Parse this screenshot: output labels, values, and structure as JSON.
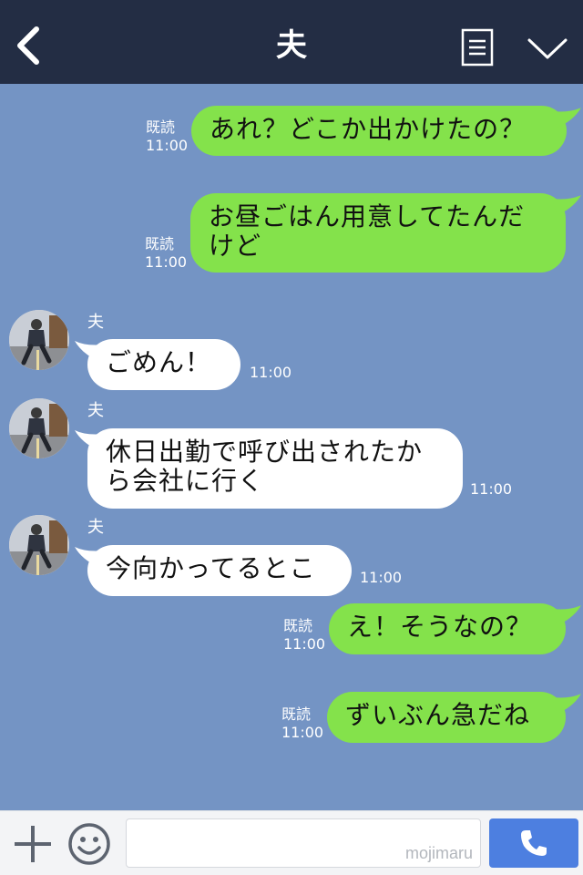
{
  "header": {
    "title": "夫"
  },
  "messages": [
    {
      "side": "right",
      "text": "あれ？どこか出かけたの？",
      "read": "既読",
      "time": "11:00"
    },
    {
      "side": "right",
      "text": "お昼ごはん用意してたんだけど",
      "read": "既読",
      "time": "11:00"
    },
    {
      "side": "left",
      "sender": "夫",
      "text": "ごめん！",
      "time": "11:00"
    },
    {
      "side": "left",
      "sender": "夫",
      "text": "休日出勤で呼び出されたから会社に行く",
      "time": "11:00"
    },
    {
      "side": "left",
      "sender": "夫",
      "text": "今向かってるとこ",
      "time": "11:00"
    },
    {
      "side": "right",
      "text": "え！そうなの？",
      "read": "既読",
      "time": "11:00"
    },
    {
      "side": "right",
      "text": "ずいぶん急だね",
      "read": "既読",
      "time": "11:00"
    }
  ],
  "input": {
    "watermark": "mojimaru",
    "value": ""
  },
  "colors": {
    "header_bg": "#232d44",
    "chat_bg": "#7494c4",
    "sent_bubble": "#84e24b",
    "received_bubble": "#ffffff",
    "call_button": "#4d7fe0"
  },
  "icons": {
    "back": "back-chevron-icon",
    "menu": "menu-list-icon",
    "collapse": "chevron-down-icon",
    "add": "plus-icon",
    "stickers": "smile-icon",
    "call": "phone-icon"
  }
}
